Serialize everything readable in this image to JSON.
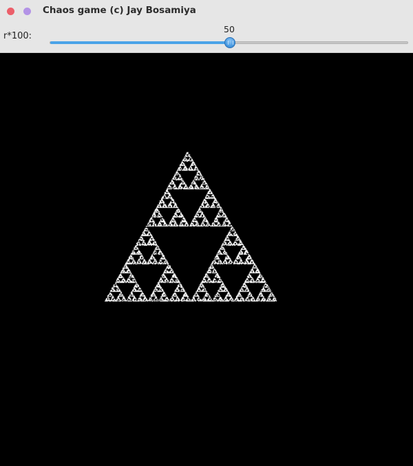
{
  "window": {
    "title": "Chaos game (c) Jay Bosamiya",
    "close_color": "#ec5f6a",
    "minimize_color": "#b393e6"
  },
  "slider": {
    "label": "r*100:",
    "value": "50",
    "min": 0,
    "max": 100,
    "fraction": 0.5,
    "accent": "#4aa3e8"
  },
  "canvas": {
    "background": "#000000",
    "point_color": "#ffffff"
  }
}
